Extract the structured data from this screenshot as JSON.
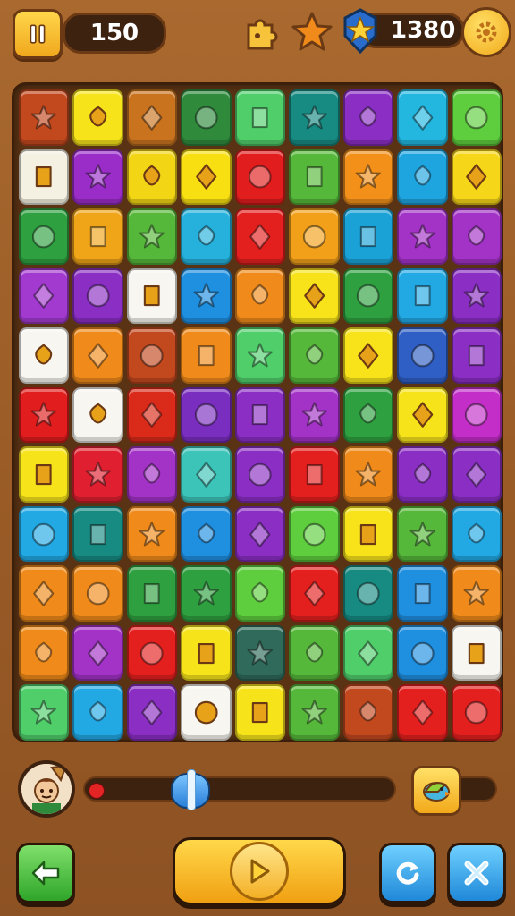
{
  "hud": {
    "score": "150",
    "coins": "1380",
    "icons": [
      "pause-icon",
      "puzzle-piece-icon",
      "star-shape-icon",
      "star-badge-icon",
      "gear-icon"
    ]
  },
  "board": {
    "rows": 11,
    "cols": 9,
    "tiles": [
      [
        "#c2491e",
        "#f6e31a",
        "#c9731f",
        "#2f8a3c",
        "#4fce6a",
        "#178a82",
        "#8a2ec4",
        "#23b7e0",
        "#5fce3e"
      ],
      [
        "#f4f1e2",
        "#9a2dc8",
        "#f2d515",
        "#f8df12",
        "#e11d1d",
        "#56b83a",
        "#f2901a",
        "#1ea5e0",
        "#f6d618"
      ],
      [
        "#2fa040",
        "#f0a418",
        "#56b83a",
        "#25b1db",
        "#e3201e",
        "#f2a01a",
        "#1aa1d6",
        "#a332c6",
        "#a332c6"
      ],
      [
        "#a33ad0",
        "#8a2ec4",
        "#f8f6f0",
        "#1f8fe0",
        "#f08a1a",
        "#f8e31a",
        "#2fa040",
        "#22a9e3",
        "#8a2ec4"
      ],
      [
        "#f8f6f0",
        "#f08a1a",
        "#c2491e",
        "#f08a1a",
        "#4fce6a",
        "#56b83a",
        "#f8e31a",
        "#2f5ec4",
        "#8a2ec4"
      ],
      [
        "#e11d1d",
        "#f8f6f0",
        "#d92a1a",
        "#7a2ec0",
        "#8a2ec4",
        "#a332c6",
        "#2fa040",
        "#f6e31a",
        "#c42ec8"
      ],
      [
        "#f6e31a",
        "#e02030",
        "#a332c6",
        "#3cc4b8",
        "#8a2ec4",
        "#e3201e",
        "#f08a1a",
        "#8a2ec4",
        "#8a2ec4"
      ],
      [
        "#22a9e3",
        "#178a82",
        "#f08a1a",
        "#1f8fe0",
        "#8a2ec4",
        "#5fce3e",
        "#f8e31a",
        "#56b83a",
        "#22a9e3"
      ],
      [
        "#f08a1a",
        "#f08a1a",
        "#2fa040",
        "#2fa040",
        "#5fce3e",
        "#e3201e",
        "#178a82",
        "#1f8fe0",
        "#f08a1a"
      ],
      [
        "#f08a1a",
        "#a332c6",
        "#e3201e",
        "#f6e31a",
        "#2f6a5a",
        "#56b83a",
        "#4fce6a",
        "#1f8fe0",
        "#f8f6f0"
      ],
      [
        "#4fce6a",
        "#22a9e3",
        "#8a2ec4",
        "#f8f6f0",
        "#f6e31a",
        "#56b83a",
        "#c2491e",
        "#e3201e",
        "#e3201e"
      ]
    ]
  },
  "progress": {
    "level": 0.33
  },
  "buttons": {
    "icons": [
      "arrow-left-icon",
      "play-icon",
      "refresh-icon",
      "shuffle-icon"
    ]
  }
}
